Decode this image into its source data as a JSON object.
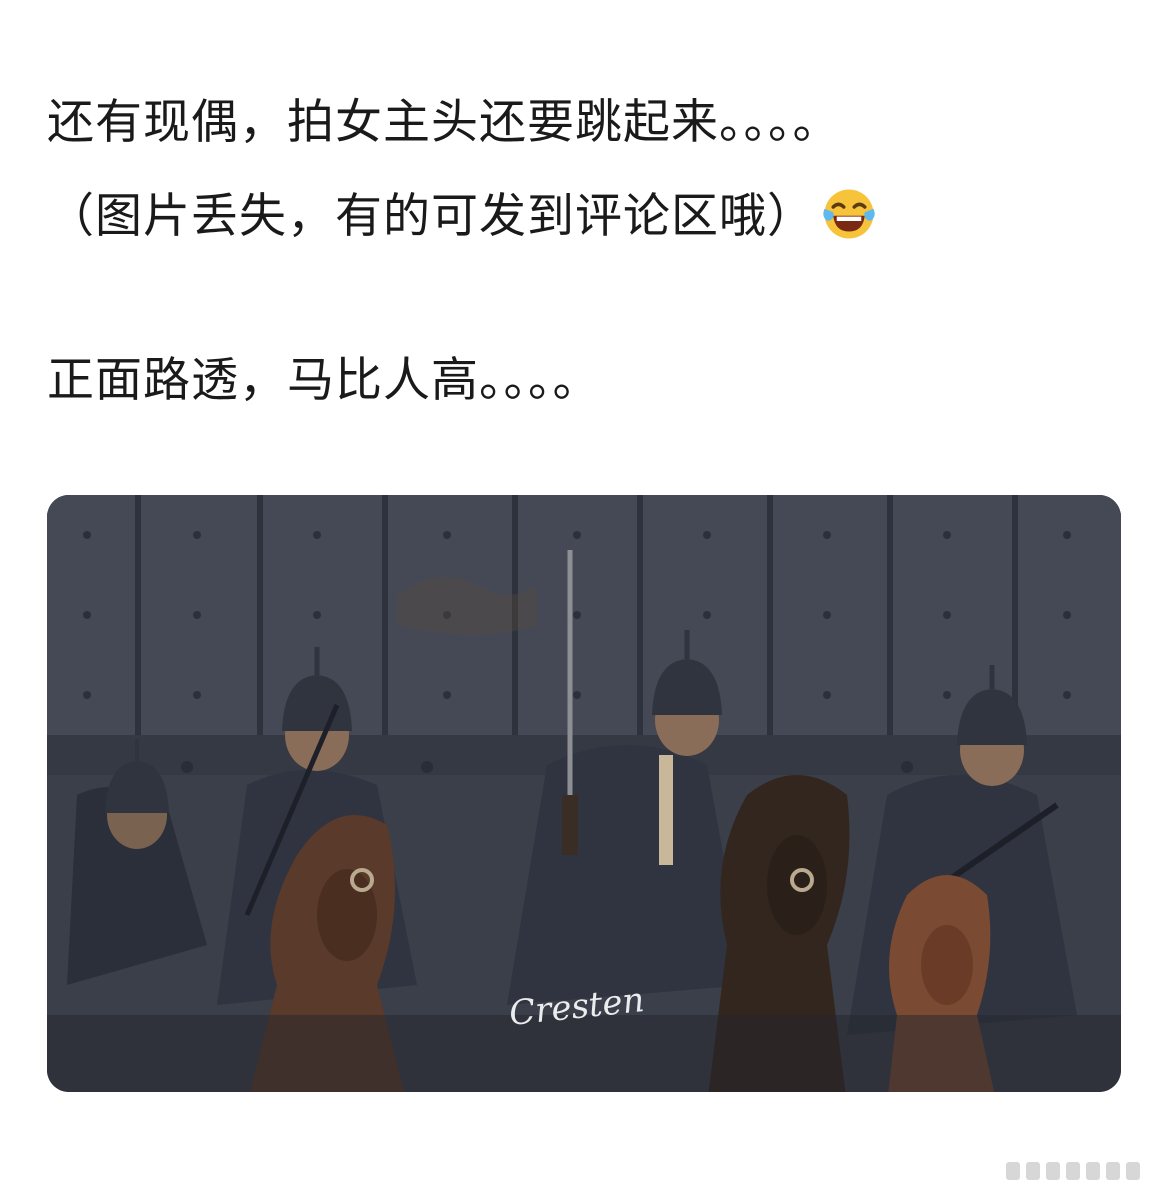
{
  "post": {
    "lines": [
      "还有现偶，拍女主头还要跳起来。。。。",
      "（图片丢失，有的可发到评论区哦）",
      "正面路透，马比人高。。。。"
    ],
    "emoji_name": "face-with-tears-of-joy-icon"
  },
  "image": {
    "signature": "Cresten",
    "description_icon": "soldiers-on-horseback-photo"
  },
  "colors": {
    "text": "#1a1a1a",
    "photo_wall": "#3b3f4a",
    "armor": "#2b2f3a"
  }
}
